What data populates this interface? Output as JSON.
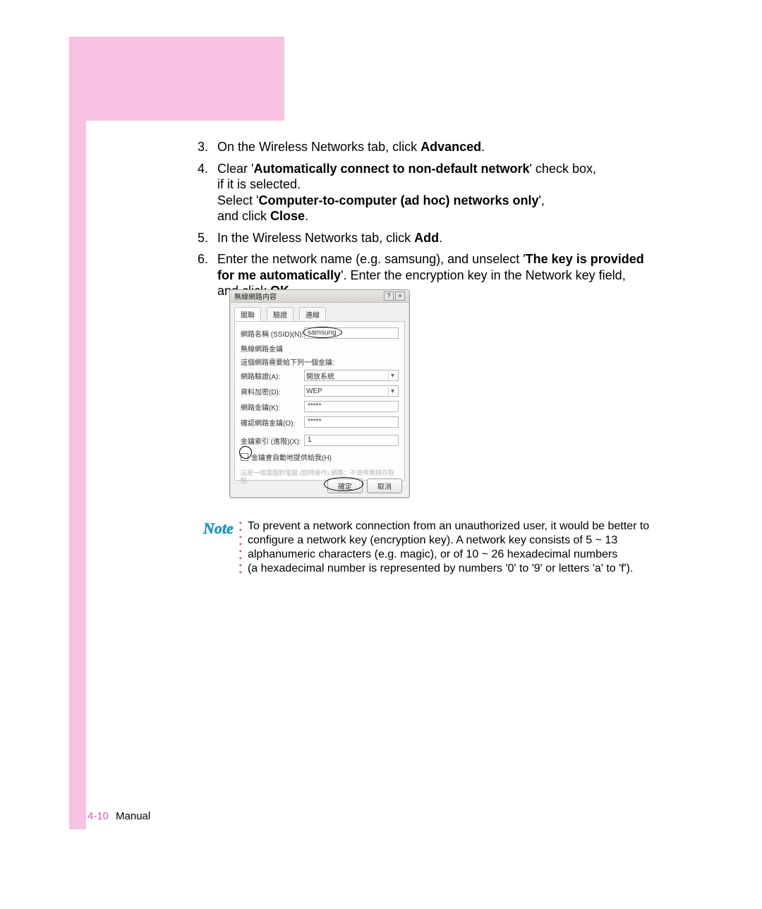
{
  "steps": {
    "s3": {
      "num": "3.",
      "pre": "On the Wireless Networks tab, click ",
      "bold": "Advanced",
      "post": "."
    },
    "s4": {
      "num": "4.",
      "line1_pre": "Clear '",
      "line1_bold": "Automatically connect to non-default network",
      "line1_post": "' check box,",
      "line2": "if it is selected.",
      "line3_pre": "Select '",
      "line3_bold": "Computer-to-computer (ad hoc) networks only",
      "line3_post": "',",
      "line4_pre": "and click ",
      "line4_bold": "Close",
      "line4_post": "."
    },
    "s5": {
      "num": "5.",
      "pre": "In the Wireless Networks tab, click ",
      "bold": "Add",
      "post": "."
    },
    "s6": {
      "num": "6.",
      "line1_pre": "Enter the network name (e.g. samsung), and unselect '",
      "line1_bold": "The key is provided",
      "line2_bold": "for me automatically",
      "line2_post": "'. Enter the encryption key in the Network key field,",
      "line3_pre": "and click ",
      "line3_bold": "OK",
      "line3_post": "."
    }
  },
  "dialog": {
    "title": "無線網路内容",
    "tabs": {
      "t1": "關聯",
      "t2": "驗證",
      "t3": "連線"
    },
    "ssid_label": "網路名稱 (SSID)(N):",
    "ssid_value": "samsung",
    "sec_header": "無線網路金鑰",
    "sec_desc": "這個網路需要給下列一個金鑰:",
    "auth_label": "網路驗證(A):",
    "auth_value": "開放系統",
    "enc_label": "資料加密(D):",
    "enc_value": "WEP",
    "key_label": "網路金鑰(K):",
    "key_value": "*****",
    "key2_label": "確認網路金鑰(O):",
    "key2_value": "*****",
    "idx_label": "金鑰索引 (進階)(X):",
    "idx_value": "1",
    "cb_label": "金鑰會自動地提供給我(H)",
    "gray_note": "這是一個電腦對電腦 (臨時操作) 網路；不使用無線存取點",
    "ok": "確定",
    "cancel": "取消"
  },
  "note": {
    "label": "Note",
    "l1": "To prevent a network connection from an unauthorized user, it would be better to",
    "l2": "configure a network key (encryption key). A network key consists of 5 ~ 13",
    "l3": "alphanumeric characters (e.g. magic), or of 10 ~ 26 hexadecimal numbers",
    "l4": "(a hexadecimal number is represented by numbers '0' to '9' or letters 'a' to 'f')."
  },
  "footer": {
    "page": "4-10",
    "label": "Manual"
  }
}
